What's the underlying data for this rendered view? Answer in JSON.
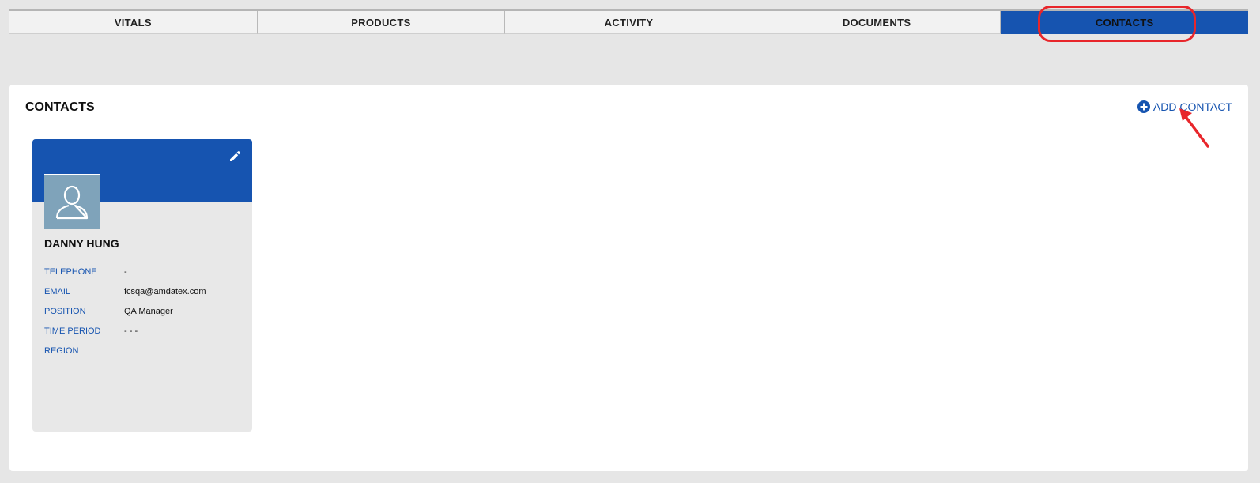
{
  "tabs": [
    {
      "label": "VITALS"
    },
    {
      "label": "PRODUCTS"
    },
    {
      "label": "ACTIVITY"
    },
    {
      "label": "DOCUMENTS"
    },
    {
      "label": "CONTACTS",
      "active": true
    }
  ],
  "panel": {
    "title": "CONTACTS",
    "add_contact_label": "ADD CONTACT"
  },
  "contact_card": {
    "name": "DANNY HUNG",
    "fields": [
      {
        "label": "TELEPHONE",
        "value": "-"
      },
      {
        "label": "EMAIL",
        "value": "fcsqa@amdatex.com"
      },
      {
        "label": "POSITION",
        "value": "QA Manager"
      },
      {
        "label": "TIME PERIOD",
        "value": "- - -"
      },
      {
        "label": "REGION",
        "value": ""
      }
    ]
  },
  "icons": {
    "add": "plus-circle-icon",
    "edit": "pencil-icon",
    "avatar": "user-silhouette-icon"
  },
  "colors": {
    "accent": "#1654b0",
    "annotation": "#e8262b",
    "avatar_bg": "#7fa3ba",
    "page_bg": "#e6e6e6"
  }
}
